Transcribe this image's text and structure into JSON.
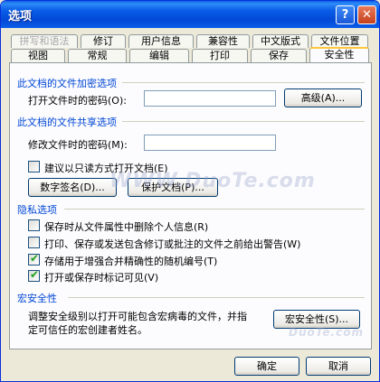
{
  "window": {
    "title": "选项"
  },
  "titlebar_buttons": {
    "help": "?",
    "close": "✕"
  },
  "tabs": {
    "row1": [
      "拼写和语法",
      "修订",
      "用户信息",
      "兼容性",
      "中文版式",
      "文件位置"
    ],
    "row2": [
      "视图",
      "常规",
      "编辑",
      "打印",
      "保存",
      "安全性"
    ],
    "active": "安全性",
    "disabled": [
      "拼写和语法"
    ]
  },
  "encryption": {
    "heading": "此文档的文件加密选项",
    "open_password_label": "打开文件时的密码(O):",
    "open_password_value": "",
    "advanced_button": "高级(A)..."
  },
  "sharing": {
    "heading": "此文档的文件共享选项",
    "modify_password_label": "修改文件时的密码(M):",
    "modify_password_value": "",
    "readonly_label": "建议以只读方式打开文档(E)",
    "readonly_checked": false,
    "digital_signature_button": "数字签名(D)...",
    "protect_document_button": "保护文档(P)..."
  },
  "privacy": {
    "heading": "隐私选项",
    "options": [
      {
        "label": "保存时从文件属性中删除个人信息(R)",
        "checked": false
      },
      {
        "label": "打印、保存或发送包含修订或批注的文件之前给出警告(W)",
        "checked": false
      },
      {
        "label": "存储用于增强合并精确性的随机编号(T)",
        "checked": true
      },
      {
        "label": "打开或保存时标记可见(V)",
        "checked": true
      }
    ]
  },
  "macro": {
    "heading": "宏安全性",
    "description_line1": "调整安全级别以打开可能包含宏病毒的文件，并指",
    "description_line2": "定可信任的宏创建者姓名。",
    "macro_security_button": "宏安全性(S)..."
  },
  "footer": {
    "ok_button": "确定",
    "cancel_button": "取消"
  },
  "watermarks": {
    "center": "WWW.DuoTe.com",
    "corner": "DuoTe.com"
  }
}
